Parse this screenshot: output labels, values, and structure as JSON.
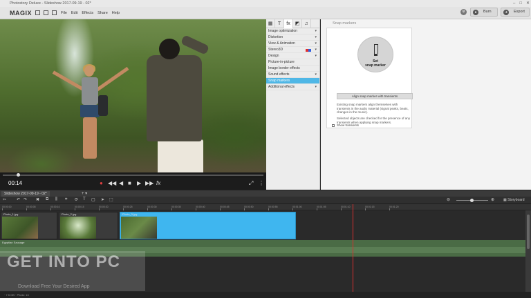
{
  "window": {
    "title": "Photostory Deluxe - Slideshow 2017-09-19 - 02*",
    "controls": [
      "–",
      "□",
      "✕"
    ]
  },
  "menubar": {
    "logo": "MAGIX",
    "items": [
      "File",
      "Edit",
      "Effects",
      "Share",
      "Help"
    ],
    "burn_label": "Burn",
    "export_label": "Export"
  },
  "preview": {
    "timecode": "00:14",
    "controls": [
      "●",
      "◀◀",
      "◀",
      "■",
      "▶",
      "▶▶",
      "fx"
    ]
  },
  "effects": {
    "tabs": [
      "▦",
      "T",
      "fx",
      "◩",
      "♫"
    ],
    "categories": [
      {
        "label": "Image optimization",
        "active": false
      },
      {
        "label": "Distortion",
        "active": false
      },
      {
        "label": "View & Animation",
        "active": false
      },
      {
        "label": "Stereo3D",
        "active": false
      },
      {
        "label": "Design",
        "active": false
      },
      {
        "label": "Picture-in-picture",
        "active": false
      },
      {
        "label": "Image border effects",
        "active": false
      },
      {
        "label": "Sound effects",
        "active": false
      },
      {
        "label": "Snap markers",
        "active": true
      },
      {
        "label": "Additional effects",
        "active": false
      }
    ]
  },
  "snap": {
    "title": "Snap markers",
    "set_line1": "Set",
    "set_line2": "snap marker",
    "align_button": "Align snap marker with transients",
    "desc1": "Existing snap markers align themselves with transients in the audio material (signal peaks, beats, changes in the music).",
    "desc2": "Selected objects are checked for the presence of any transients when applying snap markers.",
    "show_transients": "Show transients"
  },
  "timeline": {
    "tab_label": "Slideshow 2017-09-19 - 02*",
    "add_tab": "+ ▾",
    "storyboard_label": "Storyboard",
    "ruler": [
      "00:00:00",
      "00:00:05",
      "00:00:10",
      "00:00:15",
      "00:00:20",
      "00:00:25",
      "00:00:30",
      "00:00:35",
      "00:00:40",
      "00:00:45",
      "00:00:50",
      "00:00:55",
      "00:01:00",
      "00:01:05",
      "00:01:10",
      "00:01:15",
      "00:01:20"
    ],
    "clips": [
      "Photo_1.jpg",
      "Photo_2.jpg",
      "Photo_3.jpg"
    ],
    "audio_track": "Egyptian Sausage"
  },
  "status": {
    "text": "  ·  7.5 GB  ·  Photo: 13"
  },
  "watermark": {
    "main": "GET INTO PC",
    "sub": "Download Free Your Desired App"
  }
}
